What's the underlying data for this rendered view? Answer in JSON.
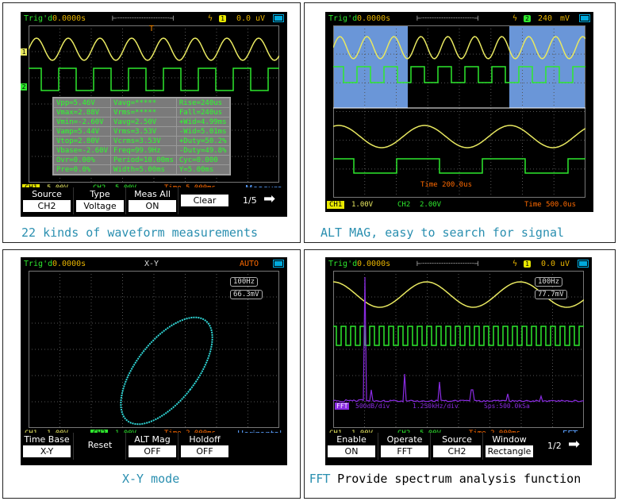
{
  "panels": {
    "measure": {
      "topbar": {
        "status": "Trig'd",
        "trig_time": "0.0000s",
        "channel": "1",
        "level": "0.0",
        "level_unit": "uV"
      },
      "measurements": [
        [
          "Vpp=5.46V",
          "Vavg=*****",
          "Rise=240us"
        ],
        [
          "Vmax=2.88V",
          "Vrms=*****",
          "Fall=240us"
        ],
        [
          "Vmin=-2.60V",
          "Vavg=2.50V",
          "+Wid=4.99ms"
        ],
        [
          "Vamp=5.44V",
          "Vrms=3.53V",
          "-Wid=5.01ms"
        ],
        [
          "Vtop=2.80V",
          "Vcrms=3.53V",
          "+Duty=50.2%"
        ],
        [
          "Vbase=-2.60V",
          "Freq=99.9Hz",
          "-Duty=49.8%"
        ],
        [
          "Ovr=0.00%",
          "Period=10.00ms",
          "Cyc=0.000"
        ],
        [
          "Pre=0.0%",
          "Width=5.00ms",
          "Y=5.00ms"
        ]
      ],
      "status": {
        "ch1": "CH1",
        "ch1_scale": "5.00V",
        "ch2": "CH2",
        "ch2_scale": "5.00V",
        "time": "Time 5.000ms",
        "menu": "Measure"
      },
      "softkeys": [
        {
          "label": "Source",
          "value": "CH2"
        },
        {
          "label": "Type",
          "value": "Voltage"
        },
        {
          "label": "Meas All",
          "value": "ON"
        },
        {
          "label": "Clear",
          "value": ""
        }
      ],
      "page": "1/5",
      "caption": "22 kinds of waveform measurements"
    },
    "altmag": {
      "topbar": {
        "status": "Trig'd",
        "trig_time": "0.0000s",
        "channel": "2",
        "level": "240",
        "level_unit": "mV"
      },
      "zoom_time": "Time 200.0us",
      "status": {
        "ch1": "CH1",
        "ch1_scale": "1.00V",
        "ch2": "CH2",
        "ch2_scale": "2.00V",
        "time": "Time 500.0us"
      },
      "caption": "ALT MAG, easy to search for signal"
    },
    "xy": {
      "topbar": {
        "status": "Trig'd",
        "trig_time": "0.0000s",
        "mode": "X-Y",
        "trigger": "AUTO"
      },
      "readout_freq": "100Hz",
      "readout_amp": "66.3mV",
      "status": {
        "ch1": "CH1",
        "ch1_scale": "1.00V",
        "ch2": "CH2",
        "ch2_scale": "1.00V",
        "time": "Time 2.000ms",
        "menu": "Horizontal"
      },
      "softkeys": [
        {
          "label": "Time Base",
          "value": "X-Y"
        },
        {
          "label": "Reset",
          "value": ""
        },
        {
          "label": "ALT Mag",
          "value": "OFF"
        },
        {
          "label": "Holdoff",
          "value": "OFF"
        }
      ],
      "caption": "X-Y mode"
    },
    "fft": {
      "topbar": {
        "status": "Trig'd",
        "trig_time": "0.0000s",
        "channel": "1",
        "level": "0.0",
        "level_unit": "uV"
      },
      "readout_freq": "100Hz",
      "readout_amp": "77.7mV",
      "fft_info": {
        "label": "FFT",
        "scale": "500dB/div",
        "center": "1.250kHz/div",
        "span": "Sps:500.0kSa"
      },
      "status": {
        "ch1": "CH1",
        "ch1_scale": "1.00V",
        "ch2": "CH2",
        "ch2_scale": "5.00V",
        "time": "Time 2.000ms",
        "menu": "FFT"
      },
      "softkeys": [
        {
          "label": "Enable",
          "value": "ON"
        },
        {
          "label": "Operate",
          "value": "FFT"
        },
        {
          "label": "Source",
          "value": "CH2"
        },
        {
          "label": "Window",
          "value": "Rectangle"
        }
      ],
      "page": "1/2",
      "caption_prefix": "FFT",
      "caption_rest": " Provide spectrum analysis function"
    }
  },
  "colors": {
    "ch1": "#e8e860",
    "ch2": "#2ee82e",
    "xy_trace": "#30d8d8",
    "fft": "#8a2be2",
    "grid": "#555555",
    "highlight": "#6a96d8"
  }
}
